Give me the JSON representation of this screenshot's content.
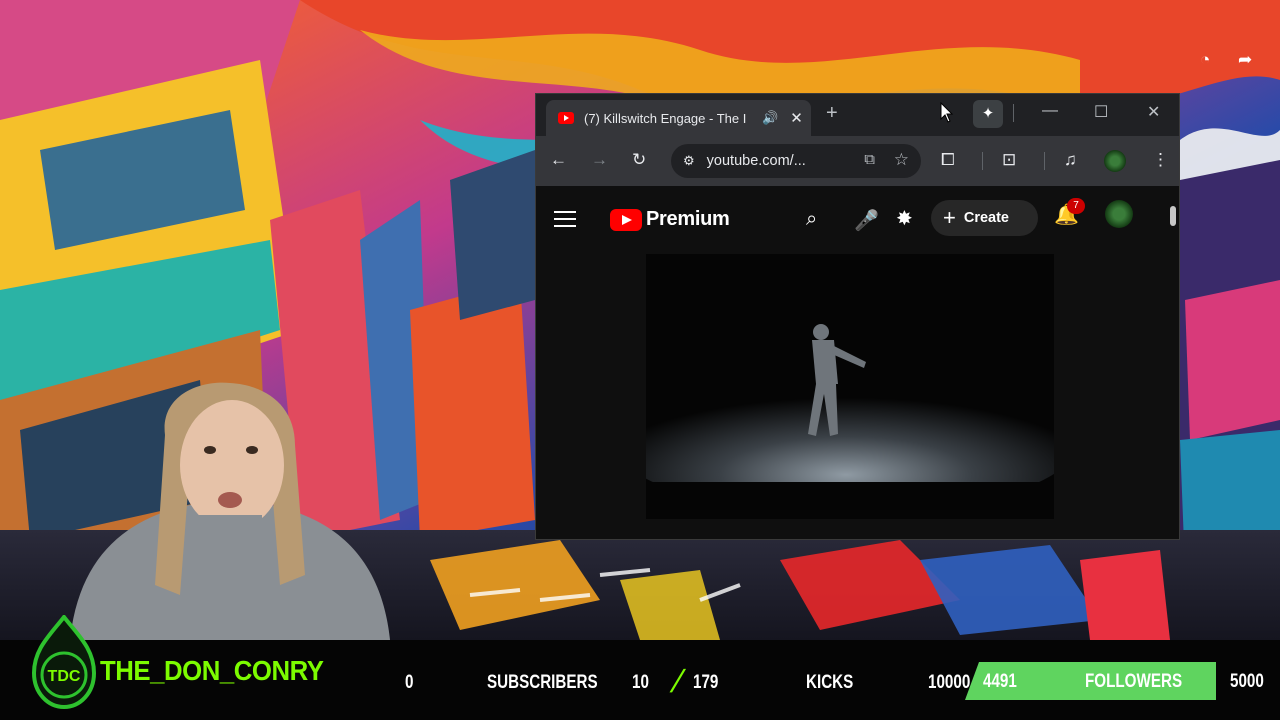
{
  "browser": {
    "tab_title": "(7) Killswitch Engage - The I",
    "new_tab": "+",
    "gemini_icon": "sparkle-icon",
    "window_controls": {
      "minimize": "—",
      "maximize": "☐",
      "close": "✕"
    },
    "tab_close": "✕",
    "url": "youtube.com/...",
    "audio_icon": "speaker-icon"
  },
  "youtube": {
    "logo_text": "Premium",
    "create_label": "Create",
    "notification_count": "7"
  },
  "overlay": {
    "logo_text": "TDC",
    "channel_name": "THE_DON_CONRY",
    "subscribers_value": "0",
    "subscribers_label": "SUBSCRIBERS",
    "kicks_current": "10",
    "kicks_total": "179",
    "kicks_label": "KICKS",
    "followers_goal_start": "10000",
    "followers_value": "4491",
    "followers_label": "FOLLOWERS",
    "followers_goal": "5000",
    "followers_progress": 0.898
  }
}
